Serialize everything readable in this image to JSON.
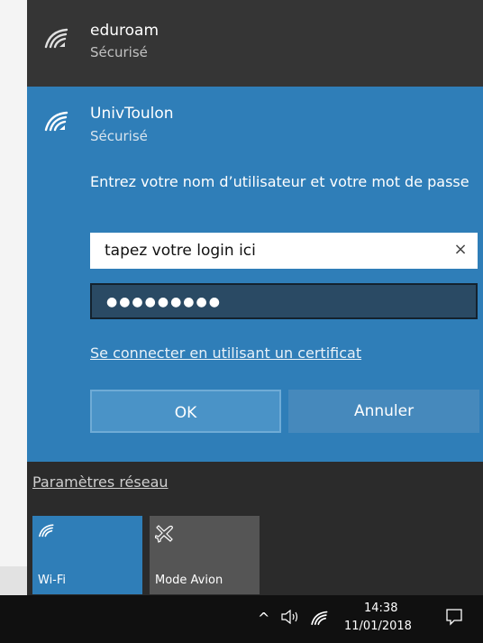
{
  "networks": [
    {
      "name": "eduroam",
      "status": "Sécurisé"
    },
    {
      "name": "UnivToulon",
      "status": "Sécurisé"
    }
  ],
  "login": {
    "prompt": "Entrez votre nom d’utilisateur et votre mot de passe",
    "username_value": "tapez votre login ici",
    "clear_glyph": "×",
    "password_mask": "●●●●●●●●●",
    "certificate_link": "Se connecter en utilisant un certificat",
    "ok_label": "OK",
    "cancel_label": "Annuler"
  },
  "settings_link": "Paramètres réseau",
  "quick_actions": [
    {
      "label": "Wi-Fi",
      "icon": "wifi-icon",
      "active": true
    },
    {
      "label": "Mode Avion",
      "icon": "airplane-icon",
      "active": false
    }
  ],
  "taskbar": {
    "time": "14:38",
    "date": "11/01/2018",
    "chevron": "^",
    "icons": [
      "chevron-up-icon",
      "volume-icon",
      "wifi-icon",
      "notification-icon"
    ]
  },
  "colors": {
    "accent": "#2f7eb8",
    "panel": "#2b2b2b",
    "taskbar": "#101010"
  }
}
